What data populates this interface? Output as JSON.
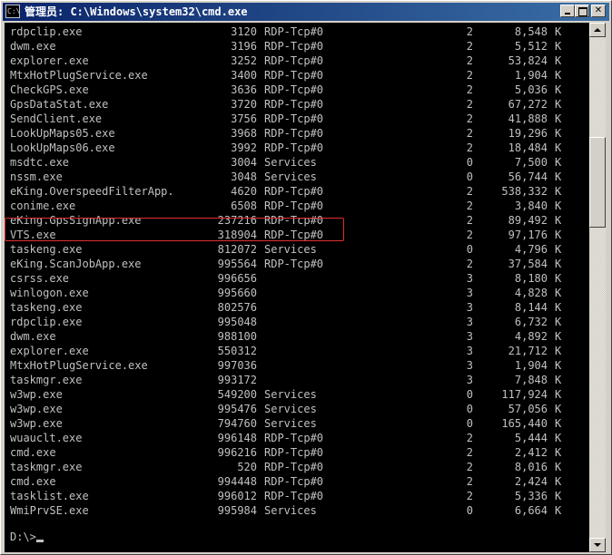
{
  "window": {
    "title": "管理员: C:\\Windows\\system32\\cmd.exe",
    "app_icon": "cmd-icon",
    "buttons": {
      "minimize": "minimize-icon",
      "maximize": "maximize-icon",
      "close_label": "✕"
    }
  },
  "console": {
    "text_color": "#c0c0c0",
    "background": "#000000",
    "rows": [
      {
        "name": "rdpclip.exe",
        "pid": "3120",
        "session": "RDP-Tcp#0",
        "num": "2",
        "mem": "8,548",
        "unit": "K"
      },
      {
        "name": "dwm.exe",
        "pid": "3196",
        "session": "RDP-Tcp#0",
        "num": "2",
        "mem": "5,512",
        "unit": "K"
      },
      {
        "name": "explorer.exe",
        "pid": "3252",
        "session": "RDP-Tcp#0",
        "num": "2",
        "mem": "53,824",
        "unit": "K"
      },
      {
        "name": "MtxHotPlugService.exe",
        "pid": "3400",
        "session": "RDP-Tcp#0",
        "num": "2",
        "mem": "1,904",
        "unit": "K"
      },
      {
        "name": "CheckGPS.exe",
        "pid": "3636",
        "session": "RDP-Tcp#0",
        "num": "2",
        "mem": "5,036",
        "unit": "K"
      },
      {
        "name": "GpsDataStat.exe",
        "pid": "3720",
        "session": "RDP-Tcp#0",
        "num": "2",
        "mem": "67,272",
        "unit": "K"
      },
      {
        "name": "SendClient.exe",
        "pid": "3756",
        "session": "RDP-Tcp#0",
        "num": "2",
        "mem": "41,888",
        "unit": "K"
      },
      {
        "name": "LookUpMaps05.exe",
        "pid": "3968",
        "session": "RDP-Tcp#0",
        "num": "2",
        "mem": "19,296",
        "unit": "K"
      },
      {
        "name": "LookUpMaps06.exe",
        "pid": "3992",
        "session": "RDP-Tcp#0",
        "num": "2",
        "mem": "18,484",
        "unit": "K"
      },
      {
        "name": "msdtc.exe",
        "pid": "3004",
        "session": "Services",
        "num": "0",
        "mem": "7,500",
        "unit": "K"
      },
      {
        "name": "nssm.exe",
        "pid": "3048",
        "session": "Services",
        "num": "0",
        "mem": "56,744",
        "unit": "K"
      },
      {
        "name": "eKing.OverspeedFilterApp.",
        "pid": "4620",
        "session": "RDP-Tcp#0",
        "num": "2",
        "mem": "538,332",
        "unit": "K"
      },
      {
        "name": "conime.exe",
        "pid": "6508",
        "session": "RDP-Tcp#0",
        "num": "2",
        "mem": "3,840",
        "unit": "K"
      },
      {
        "name": "eKing.GpsSignApp.exe",
        "pid": "237216",
        "session": "RDP-Tcp#0",
        "num": "2",
        "mem": "89,492",
        "unit": "K"
      },
      {
        "name": "VTS.exe",
        "pid": "318904",
        "session": "RDP-Tcp#0",
        "num": "2",
        "mem": "97,176",
        "unit": "K"
      },
      {
        "name": "taskeng.exe",
        "pid": "812072",
        "session": "Services",
        "num": "0",
        "mem": "4,796",
        "unit": "K"
      },
      {
        "name": "eKing.ScanJobApp.exe",
        "pid": "995564",
        "session": "RDP-Tcp#0",
        "num": "2",
        "mem": "37,584",
        "unit": "K"
      },
      {
        "name": "csrss.exe",
        "pid": "996656",
        "session": "",
        "num": "3",
        "mem": "8,180",
        "unit": "K"
      },
      {
        "name": "winlogon.exe",
        "pid": "995660",
        "session": "",
        "num": "3",
        "mem": "4,828",
        "unit": "K"
      },
      {
        "name": "taskeng.exe",
        "pid": "802576",
        "session": "",
        "num": "3",
        "mem": "8,144",
        "unit": "K"
      },
      {
        "name": "rdpclip.exe",
        "pid": "995048",
        "session": "",
        "num": "3",
        "mem": "6,732",
        "unit": "K"
      },
      {
        "name": "dwm.exe",
        "pid": "988100",
        "session": "",
        "num": "3",
        "mem": "4,892",
        "unit": "K"
      },
      {
        "name": "explorer.exe",
        "pid": "550312",
        "session": "",
        "num": "3",
        "mem": "21,712",
        "unit": "K"
      },
      {
        "name": "MtxHotPlugService.exe",
        "pid": "997036",
        "session": "",
        "num": "3",
        "mem": "1,904",
        "unit": "K"
      },
      {
        "name": "taskmgr.exe",
        "pid": "993172",
        "session": "",
        "num": "3",
        "mem": "7,848",
        "unit": "K"
      },
      {
        "name": "w3wp.exe",
        "pid": "549200",
        "session": "Services",
        "num": "0",
        "mem": "117,924",
        "unit": "K"
      },
      {
        "name": "w3wp.exe",
        "pid": "995476",
        "session": "Services",
        "num": "0",
        "mem": "57,056",
        "unit": "K"
      },
      {
        "name": "w3wp.exe",
        "pid": "794760",
        "session": "Services",
        "num": "0",
        "mem": "165,440",
        "unit": "K"
      },
      {
        "name": "wuauclt.exe",
        "pid": "996148",
        "session": "RDP-Tcp#0",
        "num": "2",
        "mem": "5,444",
        "unit": "K"
      },
      {
        "name": "cmd.exe",
        "pid": "996216",
        "session": "RDP-Tcp#0",
        "num": "2",
        "mem": "2,412",
        "unit": "K"
      },
      {
        "name": "taskmgr.exe",
        "pid": "520",
        "session": "RDP-Tcp#0",
        "num": "2",
        "mem": "8,016",
        "unit": "K"
      },
      {
        "name": "cmd.exe",
        "pid": "994448",
        "session": "RDP-Tcp#0",
        "num": "2",
        "mem": "2,424",
        "unit": "K"
      },
      {
        "name": "tasklist.exe",
        "pid": "996012",
        "session": "RDP-Tcp#0",
        "num": "2",
        "mem": "5,336",
        "unit": "K"
      },
      {
        "name": "WmiPrvSE.exe",
        "pid": "995984",
        "session": "Services",
        "num": "0",
        "mem": "6,664",
        "unit": "K"
      }
    ],
    "prompt": "D:\\>"
  },
  "annotation": {
    "highlight_color": "#e03030"
  }
}
